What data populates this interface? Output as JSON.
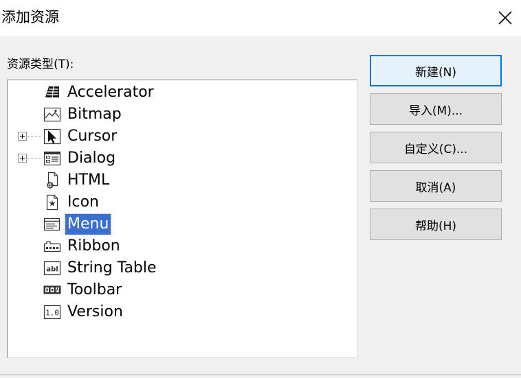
{
  "window": {
    "title": "添加资源",
    "close_glyph": "✕"
  },
  "resource_types": {
    "label": "资源类型(T):",
    "items": [
      {
        "label": "Accelerator",
        "icon": "accelerator-icon",
        "expandable": false,
        "selected": false
      },
      {
        "label": "Bitmap",
        "icon": "bitmap-icon",
        "expandable": false,
        "selected": false
      },
      {
        "label": "Cursor",
        "icon": "cursor-icon",
        "expandable": true,
        "selected": false
      },
      {
        "label": "Dialog",
        "icon": "dialog-icon",
        "expandable": true,
        "selected": false
      },
      {
        "label": "HTML",
        "icon": "html-icon",
        "expandable": false,
        "selected": false
      },
      {
        "label": "Icon",
        "icon": "icon-resource-icon",
        "expandable": false,
        "selected": false
      },
      {
        "label": "Menu",
        "icon": "menu-icon",
        "expandable": false,
        "selected": true
      },
      {
        "label": "Ribbon",
        "icon": "ribbon-icon",
        "expandable": false,
        "selected": false
      },
      {
        "label": "String Table",
        "icon": "string-table-icon",
        "expandable": false,
        "selected": false
      },
      {
        "label": "Toolbar",
        "icon": "toolbar-icon",
        "expandable": false,
        "selected": false
      },
      {
        "label": "Version",
        "icon": "version-icon",
        "expandable": false,
        "selected": false
      }
    ]
  },
  "buttons": {
    "new": "新建(N)",
    "import": "导入(M)...",
    "custom": "自定义(C)...",
    "cancel": "取消(A)",
    "help": "帮助(H)"
  },
  "icon_text": {
    "string_table": "abl",
    "version": "1.0"
  },
  "colors": {
    "selection": "#3a6fd1",
    "default_button_border": "#0078d7"
  }
}
